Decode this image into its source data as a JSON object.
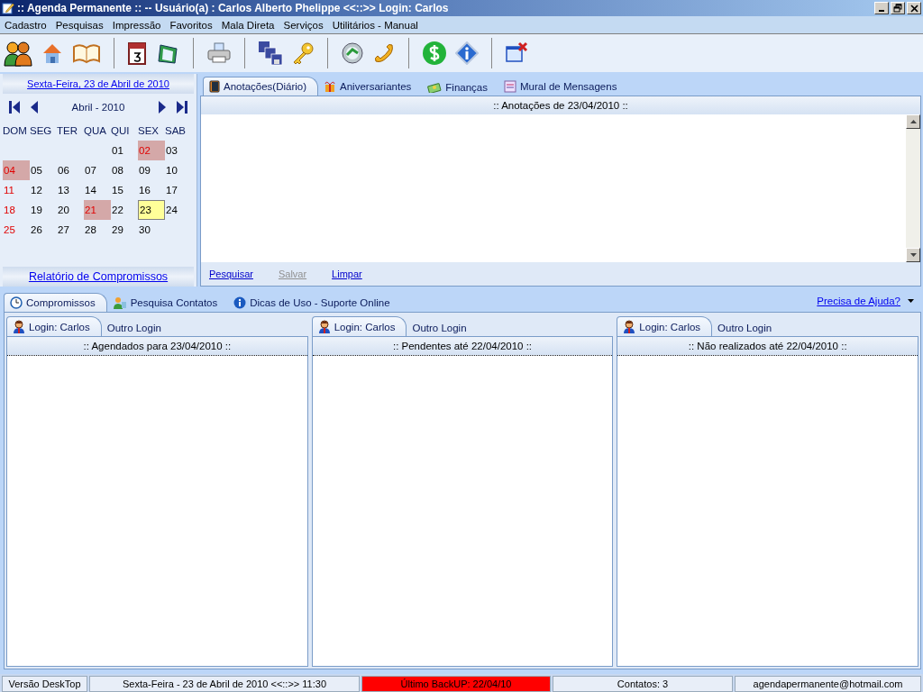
{
  "window": {
    "title": ":: Agenda Permanente :: -- Usuário(a) : Carlos Alberto Phelippe <<::>> Login: Carlos"
  },
  "menu": [
    "Cadastro",
    "Pesquisas",
    "Impressão",
    "Favoritos",
    "Mala Direta",
    "Serviços",
    "Utilitários - Manual"
  ],
  "calendar": {
    "date_link": "Sexta-Feira, 23 de Abril de 2010",
    "month": "Abril - 2010",
    "weekdays": [
      "DOM",
      "SEG",
      "TER",
      "QUA",
      "QUI",
      "SEX",
      "SAB"
    ],
    "weeks": [
      [
        {
          "day": "01",
          "kind": "normal"
        },
        {
          "day": "02",
          "kind": "holiday"
        },
        {
          "day": "03",
          "kind": "normal"
        }
      ],
      [
        {
          "day": "04",
          "kind": "holiday"
        },
        {
          "day": "05",
          "kind": "normal"
        },
        {
          "day": "06",
          "kind": "normal"
        },
        {
          "day": "07",
          "kind": "normal"
        },
        {
          "day": "08",
          "kind": "normal"
        },
        {
          "day": "09",
          "kind": "normal"
        },
        {
          "day": "10",
          "kind": "normal"
        }
      ],
      [
        {
          "day": "11",
          "kind": "sunday"
        },
        {
          "day": "12",
          "kind": "normal"
        },
        {
          "day": "13",
          "kind": "normal"
        },
        {
          "day": "14",
          "kind": "normal"
        },
        {
          "day": "15",
          "kind": "normal"
        },
        {
          "day": "16",
          "kind": "normal"
        },
        {
          "day": "17",
          "kind": "normal"
        }
      ],
      [
        {
          "day": "18",
          "kind": "sunday"
        },
        {
          "day": "19",
          "kind": "normal"
        },
        {
          "day": "20",
          "kind": "normal"
        },
        {
          "day": "21",
          "kind": "holiday"
        },
        {
          "day": "22",
          "kind": "normal"
        },
        {
          "day": "23",
          "kind": "today"
        },
        {
          "day": "24",
          "kind": "normal"
        }
      ],
      [
        {
          "day": "25",
          "kind": "sunday"
        },
        {
          "day": "26",
          "kind": "normal"
        },
        {
          "day": "27",
          "kind": "normal"
        },
        {
          "day": "28",
          "kind": "normal"
        },
        {
          "day": "29",
          "kind": "normal"
        },
        {
          "day": "30",
          "kind": "normal"
        }
      ]
    ],
    "report_link": "Relatório de Compromissos"
  },
  "notes": {
    "tabs": [
      {
        "label": "Anotações(Diário)",
        "selected": true
      },
      {
        "label": "Aniversariantes",
        "selected": false
      },
      {
        "label": "Finanças",
        "selected": false
      },
      {
        "label": "Mural de Mensagens",
        "selected": false
      }
    ],
    "header": ":: Anotações de 23/04/2010 ::",
    "actions": [
      {
        "label": "Pesquisar",
        "disabled": false
      },
      {
        "label": "Salvar",
        "disabled": true
      },
      {
        "label": "Limpar",
        "disabled": false
      }
    ]
  },
  "bottom_tabs": [
    {
      "label": "Compromissos",
      "selected": true
    },
    {
      "label": "Pesquisa Contatos",
      "selected": false
    },
    {
      "label": "Dicas de Uso - Suporte Online",
      "selected": false
    }
  ],
  "help_link": "Precisa de Ajuda?",
  "panels": [
    {
      "tabs": [
        {
          "label": "Login: Carlos",
          "selected": true
        },
        {
          "label": "Outro Login",
          "selected": false
        }
      ],
      "header": ":: Agendados para 23/04/2010 ::"
    },
    {
      "tabs": [
        {
          "label": "Login: Carlos",
          "selected": true
        },
        {
          "label": "Outro Login",
          "selected": false
        }
      ],
      "header": ":: Pendentes até 22/04/2010 ::"
    },
    {
      "tabs": [
        {
          "label": "Login: Carlos",
          "selected": true
        },
        {
          "label": "Outro Login",
          "selected": false
        }
      ],
      "header": ":: Não realizados até 22/04/2010 ::"
    }
  ],
  "status_bar": [
    {
      "text": "Versão DeskTop",
      "alert": false
    },
    {
      "text": "Sexta-Feira - 23 de Abril de 2010  <<::>>  11:30",
      "alert": false
    },
    {
      "text": "Último BackUP: 22/04/10",
      "alert": true
    },
    {
      "text": "Contatos: 3",
      "alert": false
    },
    {
      "text": "agendapermanente@hotmail.com",
      "alert": false
    }
  ]
}
